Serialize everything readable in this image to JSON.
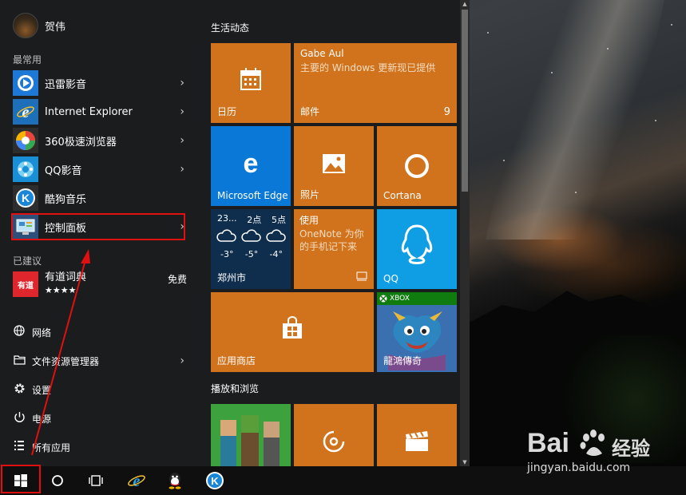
{
  "user": {
    "name": "贺伟"
  },
  "left": {
    "most_used_label": "最常用",
    "apps": [
      {
        "name": "迅雷影音",
        "icon": "xunlei-icon",
        "has_arrow": true
      },
      {
        "name": "Internet Explorer",
        "icon": "ie-icon",
        "has_arrow": true
      },
      {
        "name": "360极速浏览器",
        "icon": "360-browser-icon",
        "has_arrow": true
      },
      {
        "name": "QQ影音",
        "icon": "qqplayer-icon",
        "has_arrow": true
      },
      {
        "name": "酷狗音乐",
        "icon": "kugou-icon",
        "has_arrow": false
      },
      {
        "name": "控制面板",
        "icon": "control-panel-icon",
        "has_arrow": true
      }
    ],
    "suggested_label": "已建议",
    "suggested": {
      "name": "有道词典",
      "badge": "有道",
      "price": "免费",
      "rating": "★★★★"
    },
    "system": [
      {
        "name": "网络",
        "icon": "network-icon"
      },
      {
        "name": "文件资源管理器",
        "icon": "file-explorer-icon"
      },
      {
        "name": "设置",
        "icon": "settings-gear-icon"
      },
      {
        "name": "电源",
        "icon": "power-icon"
      },
      {
        "name": "所有应用",
        "icon": "all-apps-icon"
      }
    ],
    "chevron": "›"
  },
  "tiles": {
    "group1_title": "生活动态",
    "group2_title": "播放和浏览",
    "calendar": {
      "label": "日历"
    },
    "mail": {
      "label": "邮件",
      "sender": "Gabe Aul",
      "subject": "主要的 Windows 更新现已提供",
      "count": "9"
    },
    "edge": {
      "label": "Microsoft Edge"
    },
    "photos": {
      "label": "照片"
    },
    "cortana": {
      "label": "Cortana"
    },
    "weather": {
      "city": "郑州市",
      "hours": [
        "23...",
        "2点",
        "5点"
      ],
      "temps": [
        "-3°",
        "-5°",
        "-4°"
      ]
    },
    "onenote": {
      "title": "使用",
      "line1": "OneNote 为你",
      "line2": "的手机记下来"
    },
    "qq": {
      "label": "QQ"
    },
    "store": {
      "label": "应用商店"
    },
    "xbox_game": {
      "badge": "XBOX",
      "label": "龍鴻傳奇"
    }
  },
  "watermark": {
    "brand": "Bai",
    "brand2": "经验",
    "url": "jingyan.baidu.com"
  },
  "colors": {
    "tile_orange": "#d1731c",
    "tile_blue": "#0a78d7",
    "highlight_red": "#e01010",
    "xbox_green": "#107c10"
  }
}
